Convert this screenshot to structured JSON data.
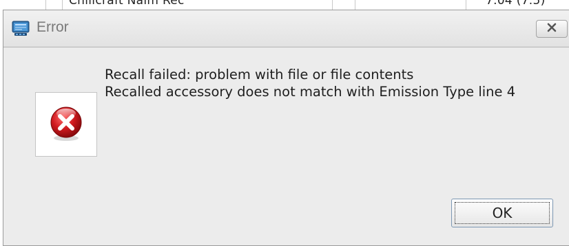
{
  "background": {
    "partial_row_text_1": "Chillcraft Naim Rec",
    "partial_row_text_2": "7.04 (7.5)"
  },
  "dialog": {
    "title": "Error",
    "title_icon": "app-monitor-icon",
    "close_icon": "close-icon",
    "error_icon": "error-icon",
    "message_lines": [
      "Recall failed: problem with file or file contents",
      "Recalled accessory does not match with Emission Type line 4"
    ],
    "ok_label": "OK"
  },
  "colors": {
    "dialog_bg": "#ececec",
    "titlebar_text": "#7a7a7a",
    "error_red": "#c8141a",
    "button_border": "#7c97b3"
  }
}
